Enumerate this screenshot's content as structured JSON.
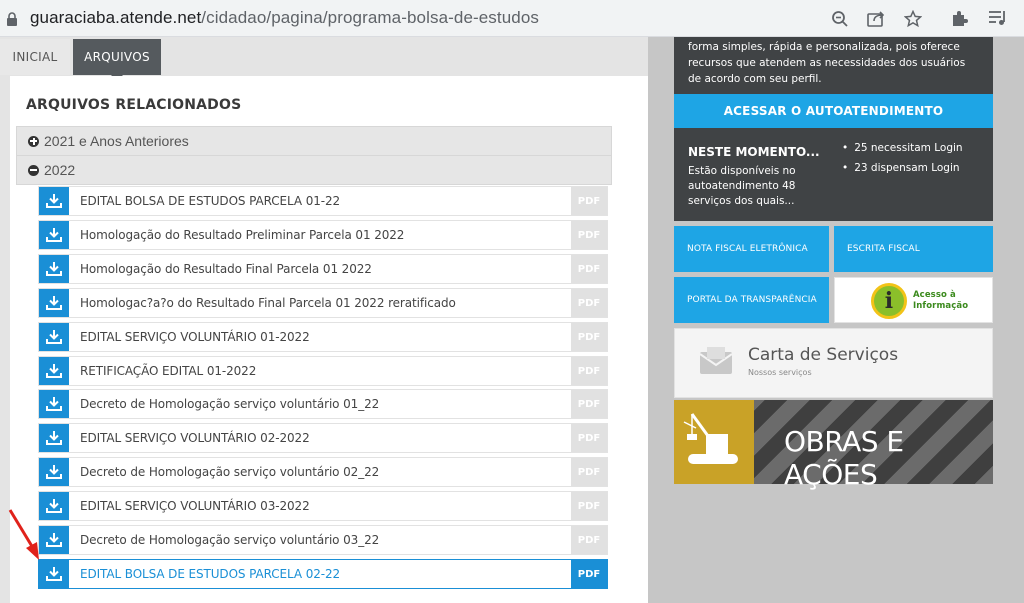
{
  "browser": {
    "url_host": "guaraciaba.atende.net",
    "url_path": "/cidadao/pagina/programa-bolsa-de-estudos"
  },
  "tabs": [
    {
      "label": "INICIAL",
      "active": false
    },
    {
      "label": "ARQUIVOS",
      "active": true
    }
  ],
  "section_title": "ARQUIVOS RELACIONADOS",
  "groups": [
    {
      "label": "2021 e Anos Anteriores",
      "expanded": false
    },
    {
      "label": "2022",
      "expanded": true
    }
  ],
  "files": [
    {
      "name": "EDITAL BOLSA DE ESTUDOS PARCELA 01-22",
      "type": "PDF"
    },
    {
      "name": "Homologação do Resultado Preliminar Parcela 01 2022",
      "type": "PDF"
    },
    {
      "name": "Homologação do Resultado Final Parcela 01 2022",
      "type": "PDF"
    },
    {
      "name": "Homologac?a?o do Resultado Final Parcela 01 2022 reratificado",
      "type": "PDF"
    },
    {
      "name": "EDITAL SERVIÇO VOLUNTÁRIO 01-2022",
      "type": "PDF"
    },
    {
      "name": "RETIFICAÇÃO EDITAL 01-2022",
      "type": "PDF"
    },
    {
      "name": "Decreto de Homologação serviço voluntário 01_22",
      "type": "PDF"
    },
    {
      "name": "EDITAL SERVIÇO VOLUNTÁRIO 02-2022",
      "type": "PDF"
    },
    {
      "name": "Decreto de Homologação serviço voluntário 02_22",
      "type": "PDF"
    },
    {
      "name": "EDITAL SERVIÇO VOLUNTÁRIO 03-2022",
      "type": "PDF"
    },
    {
      "name": "Decreto de Homologação serviço voluntário 03_22",
      "type": "PDF"
    },
    {
      "name": "EDITAL BOLSA DE ESTUDOS PARCELA 02-22",
      "type": "PDF",
      "highlighted": true
    }
  ],
  "sidebar": {
    "intro_text": "forma simples, rápida e personalizada, pois oferece recursos que atendem as necessidades dos usuários de acordo com seu perfil.",
    "autoatendimento_button": "ACESSAR O AUTOATENDIMENTO",
    "moment_title": "NESTE MOMENTO...",
    "moment_desc": "Estão disponíveis no autoatendimento 48 serviços dos quais...",
    "moment_items": [
      "25 necessitam Login",
      "23 dispensam Login"
    ],
    "tiles": {
      "nota_fiscal": "NOTA FISCAL ELETRÔNICA",
      "escrita_fiscal": "ESCRITA FISCAL",
      "portal_transparencia": "PORTAL DA TRANSPARÊNCIA",
      "acesso_informacao_1": "Acesso à",
      "acesso_informacao_2": "Informação",
      "info_glyph": "i"
    },
    "carta_title": "Carta de Serviços",
    "carta_sub": "Nossos serviços",
    "obras_title": "OBRAS E AÇÕES"
  },
  "colors": {
    "accent_blue": "#1a8fd6",
    "dark_panel": "#404345",
    "tile_blue": "#1ea5e5",
    "arrow_red": "#e0221b"
  }
}
